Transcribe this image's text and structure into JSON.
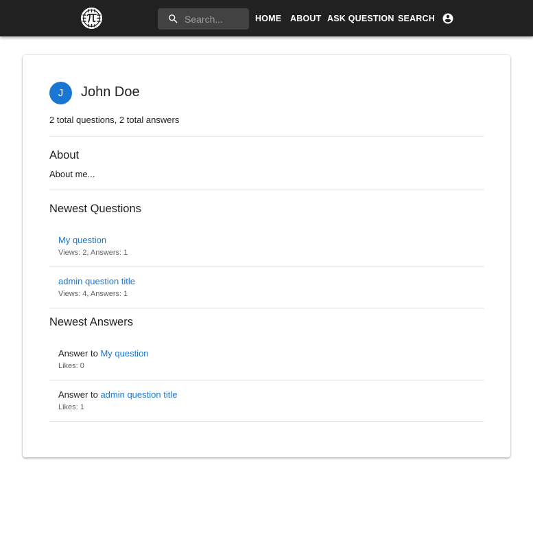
{
  "header": {
    "logo_icon": "pi-logo-icon",
    "search": {
      "placeholder": "Search...",
      "value": "",
      "icon": "search-icon"
    },
    "nav": [
      {
        "label": "HOME"
      },
      {
        "label": "ABOUT"
      },
      {
        "label": "ASK QUESTION"
      },
      {
        "label": "SEARCH"
      }
    ],
    "account_icon": "account-circle-icon"
  },
  "profile": {
    "avatar_initial": "J",
    "avatar_color": "#1976d2",
    "name": "John Doe",
    "stats": "2 total questions, 2 total answers",
    "about_title": "About",
    "about_text": "About me..."
  },
  "questions": {
    "title": "Newest Questions",
    "items": [
      {
        "title": "My question",
        "meta": "Views: 2, Answers: 1"
      },
      {
        "title": "admin question title",
        "meta": "Views: 4, Answers: 1"
      }
    ]
  },
  "answers": {
    "title": "Newest Answers",
    "prefix": "Answer to",
    "items": [
      {
        "question": "My question",
        "meta": "Likes: 0"
      },
      {
        "question": "admin question title",
        "meta": "Likes: 1"
      }
    ]
  },
  "colors": {
    "appbar": "#212121",
    "link": "#1976d2",
    "search_bg": "#424242"
  }
}
